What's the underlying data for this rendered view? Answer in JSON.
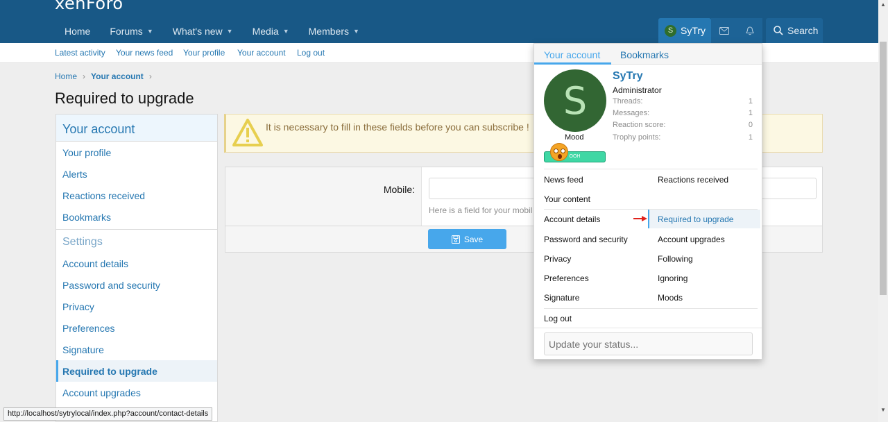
{
  "header": {
    "logo": "xenForo",
    "nav": [
      {
        "label": "Home",
        "caret": false
      },
      {
        "label": "Forums",
        "caret": true
      },
      {
        "label": "What's new",
        "caret": true
      },
      {
        "label": "Media",
        "caret": true
      },
      {
        "label": "Members",
        "caret": true
      }
    ],
    "user_initial": "S",
    "user_name": "SyTry",
    "search_label": "Search"
  },
  "subnav": [
    "Latest activity",
    "Your news feed",
    "Your profile",
    "Your account",
    "Log out"
  ],
  "breadcrumb": {
    "home": "Home",
    "current": "Your account"
  },
  "page_title": "Required to upgrade",
  "sidebar": {
    "heading": "Your account",
    "items": [
      "Your profile",
      "Alerts",
      "Reactions received",
      "Bookmarks"
    ],
    "settings_heading": "Settings",
    "settings_items": [
      "Account details",
      "Password and security",
      "Privacy",
      "Preferences",
      "Signature",
      "Required to upgrade",
      "Account upgrades"
    ],
    "active": "Required to upgrade"
  },
  "notice": "It is necessary to fill in these fields before you can subscribe !",
  "form": {
    "label": "Mobile:",
    "input_value": "",
    "hint": "Here is a field for your mobil",
    "save": "Save"
  },
  "popup": {
    "tabs": [
      "Your account",
      "Bookmarks"
    ],
    "avatar_initial": "S",
    "mood_label": "Mood",
    "mood_badge": "OOH",
    "username": "SyTry",
    "role": "Administrator",
    "stats": [
      {
        "label": "Threads:",
        "value": "1"
      },
      {
        "label": "Messages:",
        "value": "1"
      },
      {
        "label": "Reaction score:",
        "value": "0"
      },
      {
        "label": "Trophy points:",
        "value": "1"
      }
    ],
    "links_top_left": [
      "News feed",
      "Your content"
    ],
    "links_top_right": [
      "Reactions received"
    ],
    "links_left": [
      "Account details",
      "Password and security",
      "Privacy",
      "Preferences",
      "Signature"
    ],
    "links_right": [
      "Required to upgrade",
      "Account upgrades",
      "Following",
      "Ignoring",
      "Moods"
    ],
    "logout": "Log out",
    "status_placeholder": "Update your status..."
  },
  "statusbar": "http://localhost/sytrylocal/index.php?account/contact-details",
  "colors": {
    "header": "#185886",
    "accent": "#47a7eb",
    "link": "#2577b1"
  }
}
